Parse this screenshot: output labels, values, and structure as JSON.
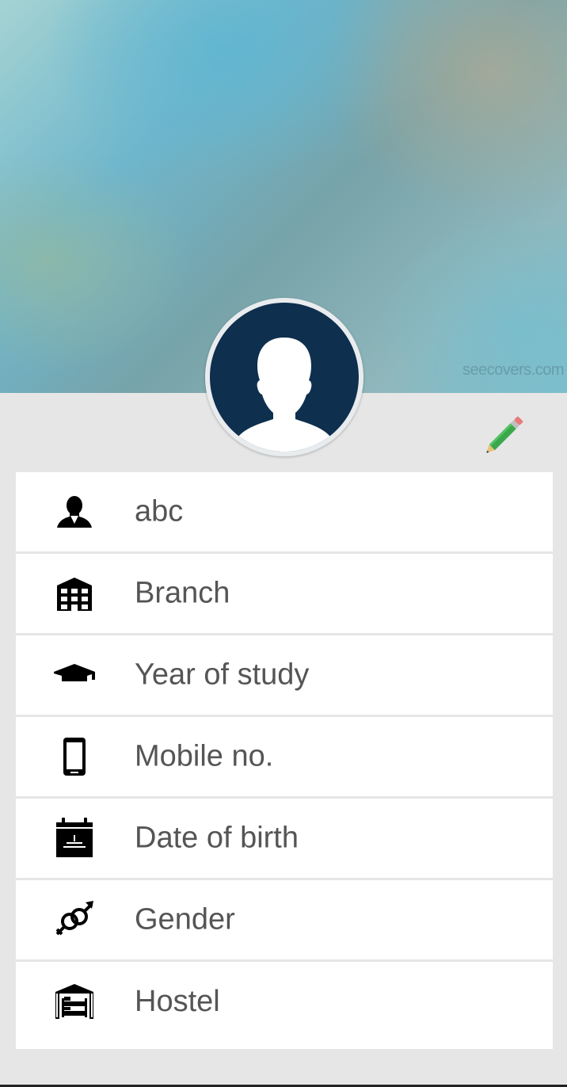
{
  "cover": {
    "watermark": "seecovers.com"
  },
  "profile": {
    "avatar_icon": "person-silhouette",
    "edit_icon": "pencil-icon"
  },
  "fields": [
    {
      "icon": "person-icon",
      "label": "abc"
    },
    {
      "icon": "building-icon",
      "label": "Branch"
    },
    {
      "icon": "graduation-cap-icon",
      "label": "Year of study"
    },
    {
      "icon": "mobile-phone-icon",
      "label": "Mobile no."
    },
    {
      "icon": "birthday-calendar-icon",
      "label": "Date of birth"
    },
    {
      "icon": "gender-icon",
      "label": "Gender"
    },
    {
      "icon": "hostel-icon",
      "label": "Hostel"
    }
  ],
  "colors": {
    "background": "#e6e6e6",
    "row_background": "#ffffff",
    "label_text": "#555555",
    "avatar_background": "#0e2f4e",
    "pencil_green": "#3aa84a"
  }
}
